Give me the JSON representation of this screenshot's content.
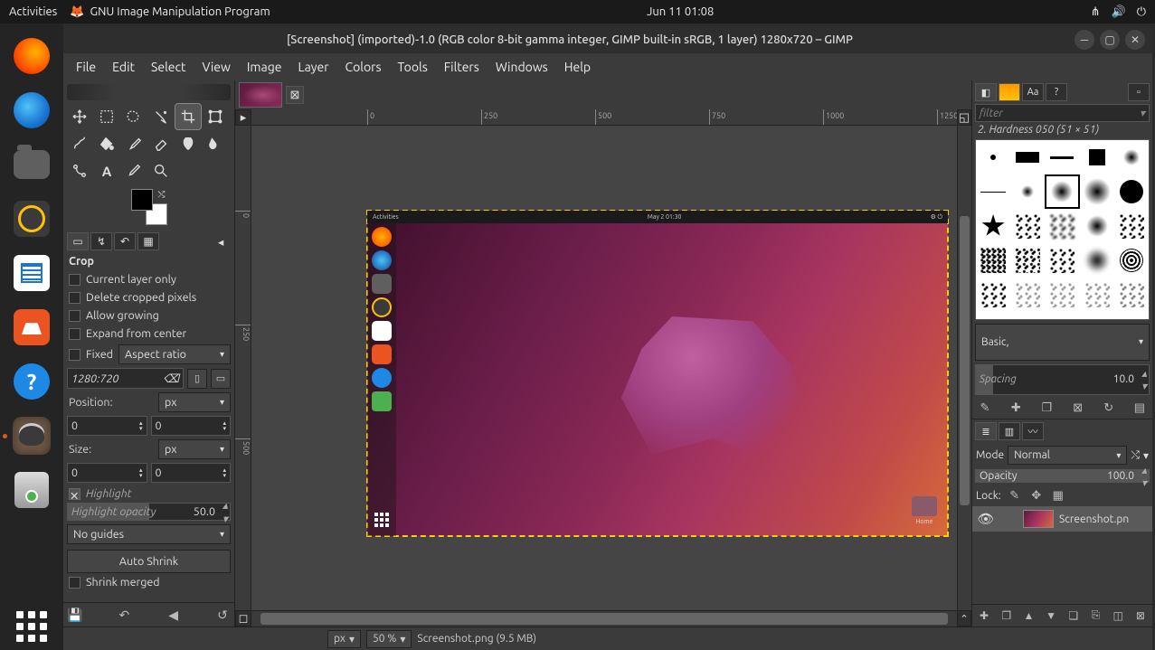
{
  "topbar": {
    "activities": "Activities",
    "app_name": "GNU Image Manipulation Program",
    "clock": "Jun 11  01:08"
  },
  "window": {
    "title": "[Screenshot] (imported)-1.0 (RGB color 8-bit gamma integer, GIMP built-in sRGB, 1 layer) 1280x720 – GIMP"
  },
  "menu": [
    "File",
    "Edit",
    "Select",
    "View",
    "Image",
    "Layer",
    "Colors",
    "Tools",
    "Filters",
    "Windows",
    "Help"
  ],
  "tool_options": {
    "title": "Crop",
    "current_layer_only": "Current layer only",
    "delete_cropped": "Delete cropped pixels",
    "allow_growing": "Allow growing",
    "expand_center": "Expand from center",
    "fixed": "Fixed",
    "fixed_mode": "Aspect ratio",
    "fixed_value": "1280:720",
    "position_label": "Position:",
    "unit": "px",
    "pos_x": "0",
    "pos_y": "0",
    "size_label": "Size:",
    "size_w": "0",
    "size_h": "0",
    "highlight": "Highlight",
    "highlight_opacity_label": "Highlight opacity",
    "highlight_opacity_value": "50.0",
    "guides": "No guides",
    "auto_shrink": "Auto Shrink",
    "shrink_merged": "Shrink merged"
  },
  "statusbar": {
    "unit": "px",
    "zoom": "50 %",
    "message": "Screenshot.png (9.5 MB)"
  },
  "brushes": {
    "filter_placeholder": "filter",
    "current": "2. Hardness 050 (51 × 51)",
    "preset": "Basic,",
    "spacing_label": "Spacing",
    "spacing_value": "10.0"
  },
  "layers": {
    "mode_label": "Mode",
    "mode_value": "Normal",
    "opacity_label": "Opacity",
    "opacity_value": "100.0",
    "lock_label": "Lock:",
    "layer_name": "Screenshot.pn"
  },
  "canvas_inner": {
    "activities": "Activities",
    "clock": "May 2  01:30",
    "home": "Home"
  },
  "ruler_h": [
    "0",
    "250",
    "500",
    "750",
    "1000",
    "1250"
  ],
  "ruler_v": [
    "0",
    "250",
    "500"
  ]
}
